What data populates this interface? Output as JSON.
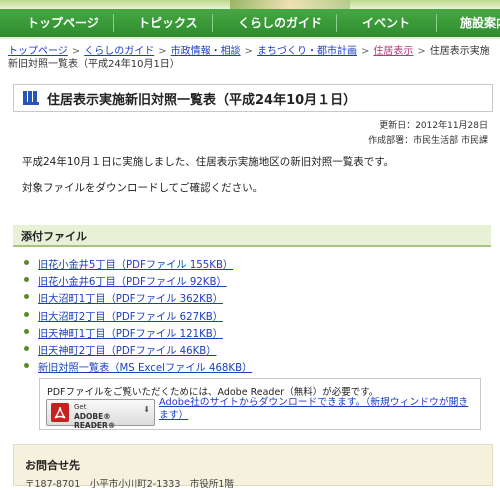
{
  "nav": {
    "items": [
      "トップページ",
      "トピックス",
      "くらしのガイド",
      "イベント",
      "施設案内"
    ]
  },
  "breadcrumb": {
    "items": [
      "トップページ",
      "くらしのガイド",
      "市政情報・相談",
      "まちづくり・都市計画",
      "住居表示"
    ],
    "current": "住居表示実施新旧対照一覧表（平成24年10月1日）"
  },
  "page": {
    "title": "住居表示実施新旧対照一覧表（平成24年10月１日）",
    "updated": "更新日：2012年11月28日",
    "department": "作成部署：市民生活部 市民課",
    "body_line1": "平成24年10月１日に実施しました、住居表示実施地区の新旧対照一覧表です。",
    "body_line2": "対象ファイルをダウンロードしてご確認ください。"
  },
  "attachments": {
    "heading": "添付ファイル",
    "files": [
      "旧花小金井5丁目（PDFファイル 155KB）",
      "旧花小金井6丁目（PDFファイル 92KB）",
      "旧大沼町1丁目（PDFファイル 362KB）",
      "旧大沼町2丁目（PDFファイル 627KB）",
      "旧天神町1丁目（PDFファイル 121KB）",
      "旧天神町2丁目（PDFファイル 46KB）",
      "新旧対照一覧表（MS Excelファイル 468KB）"
    ]
  },
  "reader": {
    "note": "PDFファイルをご覧いただくためには、Adobe Reader（無料）が必要です。",
    "badge_get": "Get",
    "badge_name": "ADOBE® READER®",
    "link": "Adobe社のサイトからダウンロードできます。（新規ウィンドウが開きます）"
  },
  "contact": {
    "heading": "お問合せ先",
    "address": "〒187-8701　小平市小川町2-1333　市役所1階"
  },
  "colors": {
    "nav_green": "#3a9a38",
    "link_blue": "#1a3fbf",
    "section_bg": "#e8f0d5",
    "contact_bg": "#f6f1dc"
  }
}
